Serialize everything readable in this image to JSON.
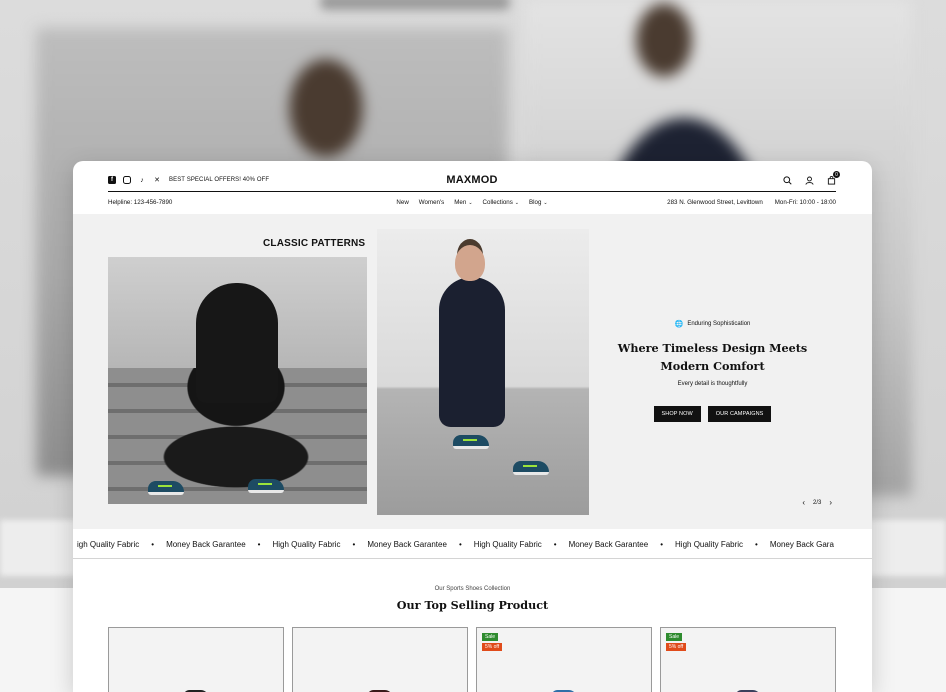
{
  "top_bar": {
    "promo": "BEST SPECIAL OFFERS! 40% OFF",
    "logo": "MAXMOD",
    "social_icons": [
      "facebook-icon",
      "instagram-icon",
      "tiktok-icon",
      "x-icon"
    ],
    "cart_count": "0"
  },
  "nav_bar": {
    "helpline": "Helpline: 123-456-7890",
    "menu": [
      {
        "label": "New",
        "dropdown": false
      },
      {
        "label": "Women's",
        "dropdown": false
      },
      {
        "label": "Men",
        "dropdown": true
      },
      {
        "label": "Collections",
        "dropdown": true
      },
      {
        "label": "Blog",
        "dropdown": true
      }
    ],
    "address": "283 N. Glenwood Street, Levittown",
    "hours": "Mon-Fri: 10:00 - 18:00"
  },
  "hero": {
    "heading": "CLASSIC PATTERNS",
    "eyebrow": "Enduring Sophistication",
    "title_line1": "Where Timeless Design Meets",
    "title_line2": "Modern Comfort",
    "subtitle": "Every detail is thoughtfully",
    "primary_button": "SHOP NOW",
    "secondary_button": "OUR CAMPAIGNS",
    "pager": "2/3"
  },
  "marquee": {
    "items": [
      "igh Quality Fabric",
      "Money Back Garantee",
      "High Quality Fabric",
      "Money Back Garantee",
      "High Quality Fabric",
      "Money Back Garantee",
      "High Quality Fabric",
      "Money Back Gara"
    ]
  },
  "products_section": {
    "eyebrow": "Our Sports Shoes Collection",
    "title": "Our Top Selling Product",
    "cards": [
      {
        "sale": "",
        "discount": "",
        "shoe_color": "#222222"
      },
      {
        "sale": "",
        "discount": "",
        "shoe_color": "#3a1a1a"
      },
      {
        "sale": "Sale",
        "discount": "5% off",
        "shoe_color": "#2f6fa8"
      },
      {
        "sale": "Sale",
        "discount": "5% off",
        "shoe_color": "#3b3f5c"
      }
    ]
  },
  "colors": {
    "sale_badge": "#2e8b2e",
    "discount_badge": "#e04b1a",
    "button": "#111111"
  }
}
